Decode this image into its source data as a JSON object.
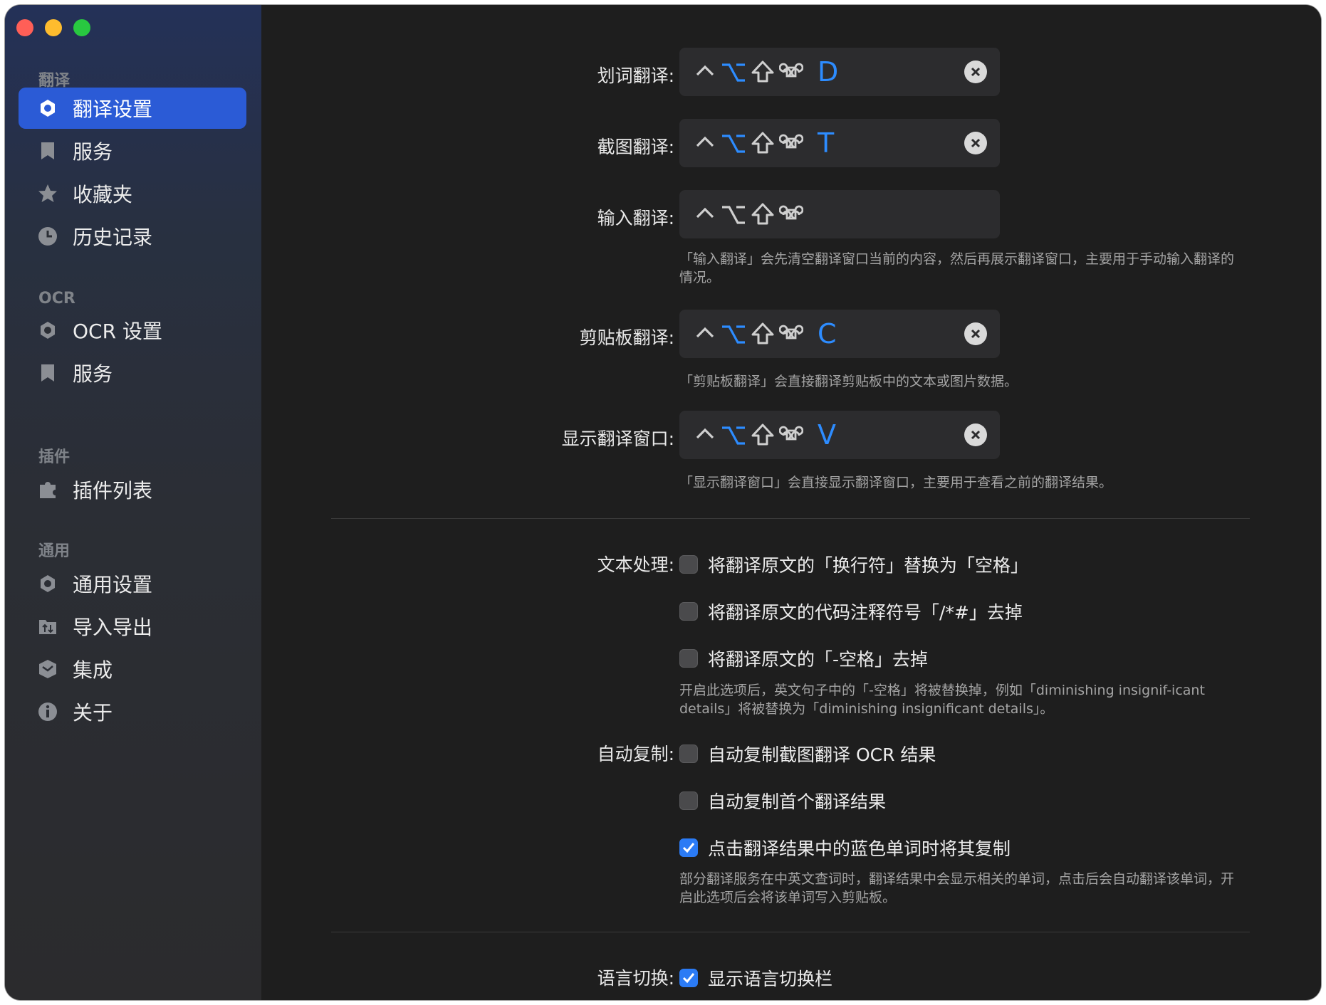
{
  "sidebar": {
    "sections": [
      {
        "title": "翻译",
        "items": [
          {
            "label": "翻译设置",
            "icon": "gear-icon",
            "active": true
          },
          {
            "label": "服务",
            "icon": "bookmark-icon"
          },
          {
            "label": "收藏夹",
            "icon": "star-icon"
          },
          {
            "label": "历史记录",
            "icon": "clock-icon"
          }
        ]
      },
      {
        "title": "OCR",
        "items": [
          {
            "label": "OCR 设置",
            "icon": "gear-icon"
          },
          {
            "label": "服务",
            "icon": "bookmark-icon"
          }
        ]
      },
      {
        "title": "插件",
        "items": [
          {
            "label": "插件列表",
            "icon": "puzzle-icon"
          }
        ]
      },
      {
        "title": "通用",
        "items": [
          {
            "label": "通用设置",
            "icon": "gear-icon"
          },
          {
            "label": "导入导出",
            "icon": "folder-transfer-icon"
          },
          {
            "label": "集成",
            "icon": "cube-icon"
          },
          {
            "label": "关于",
            "icon": "info-icon"
          }
        ]
      }
    ]
  },
  "hotkeys": [
    {
      "label": "划词翻译:",
      "key": "D",
      "clearable": true
    },
    {
      "label": "截图翻译:",
      "key": "T",
      "clearable": true
    },
    {
      "label": "输入翻译:",
      "key": "",
      "clearable": false
    },
    {
      "label": "剪贴板翻译:",
      "key": "C",
      "clearable": true
    },
    {
      "label": "显示翻译窗口:",
      "key": "V",
      "clearable": true
    }
  ],
  "notes": {
    "input": "「输入翻译」会先清空翻译窗口当前的内容，然后再展示翻译窗口，主要用于手动输入翻译的情况。",
    "clipboard": "「剪贴板翻译」会直接翻译剪贴板中的文本或图片数据。",
    "show_window": "「显示翻译窗口」会直接显示翻译窗口，主要用于查看之前的翻译结果。",
    "dash_space": "开启此选项后，英文句子中的「-空格」将被替换掉，例如「diminishing insignif-icant details」将被替换为「diminishing insignificant details」。",
    "blue_word": "部分翻译服务在中英文查词时，翻译结果中会显示相关的单词，点击后会自动翻译该单词，开启此选项后会将该单词写入剪贴板。"
  },
  "text_processing": {
    "label": "文本处理:",
    "options": [
      {
        "text": "将翻译原文的「换行符」替换为「空格」",
        "checked": false
      },
      {
        "text": "将翻译原文的代码注释符号「/*#」去掉",
        "checked": false
      },
      {
        "text": "将翻译原文的「-空格」去掉",
        "checked": false
      }
    ]
  },
  "auto_copy": {
    "label": "自动复制:",
    "options": [
      {
        "text": "自动复制截图翻译 OCR 结果",
        "checked": false
      },
      {
        "text": "自动复制首个翻译结果",
        "checked": false
      },
      {
        "text": "点击翻译结果中的蓝色单词时将其复制",
        "checked": true
      }
    ]
  },
  "language_switch": {
    "label": "语言切换:",
    "options": [
      {
        "text": "显示语言切换栏",
        "checked": true
      }
    ]
  },
  "colors": {
    "accent": "#2b5bd6",
    "hotkey_letter": "#2d8cff",
    "checkbox_on": "#2b7bf5"
  }
}
